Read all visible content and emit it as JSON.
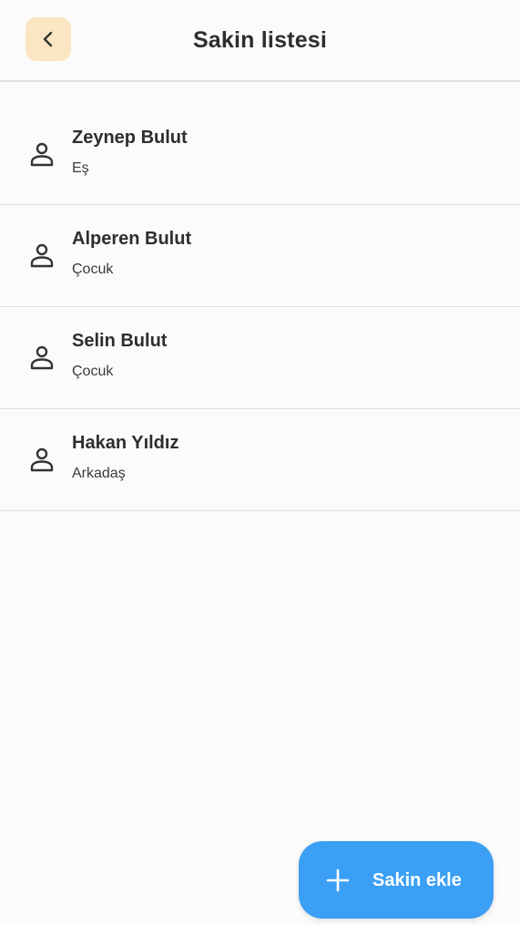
{
  "header": {
    "title": "Sakin listesi",
    "back_icon": "chevron-left-icon"
  },
  "residents": [
    {
      "name": "Zeynep Bulut",
      "relation": "Eş",
      "icon": "person-icon"
    },
    {
      "name": "Alperen Bulut",
      "relation": "Çocuk",
      "icon": "person-icon"
    },
    {
      "name": "Selin Bulut",
      "relation": "Çocuk",
      "icon": "person-icon"
    },
    {
      "name": "Hakan Yıldız",
      "relation": "Arkadaş",
      "icon": "person-icon"
    }
  ],
  "add_button": {
    "label": "Sakin ekle",
    "icon": "plus-icon"
  },
  "colors": {
    "back_button_bg": "#fbe5c2",
    "fab_bg": "#3ba0f5",
    "background": "#fbfbfb",
    "divider": "#dedede"
  }
}
